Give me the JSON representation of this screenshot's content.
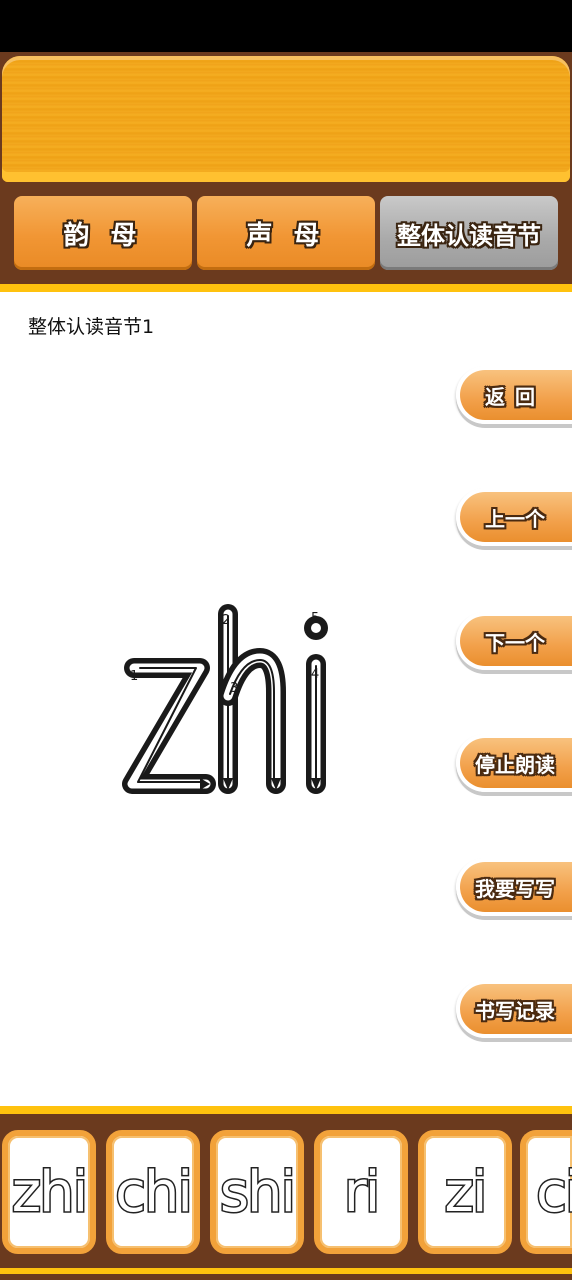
{
  "tabs": [
    {
      "label": "韵 母",
      "active": false
    },
    {
      "label": "声 母",
      "active": false
    },
    {
      "label": "整体认读音节",
      "active": true
    }
  ],
  "page_title": "整体认读音节1",
  "side_buttons": {
    "back": "返回",
    "prev": "上一个",
    "next": "下一个",
    "stop_reading": "停止朗读",
    "want_write": "我要写写",
    "write_record": "书写记录"
  },
  "current_syllable": {
    "text": "zhi",
    "stroke_numbers": [
      "1",
      "2",
      "3",
      "4",
      "5"
    ]
  },
  "syllable_list": [
    "zhi",
    "chi",
    "shi",
    "ri",
    "zi",
    "ci"
  ],
  "colors": {
    "brown": "#6b3a1e",
    "orange": "#f19634",
    "yellow": "#ffc20e",
    "gray_active": "#a9a9a9"
  }
}
